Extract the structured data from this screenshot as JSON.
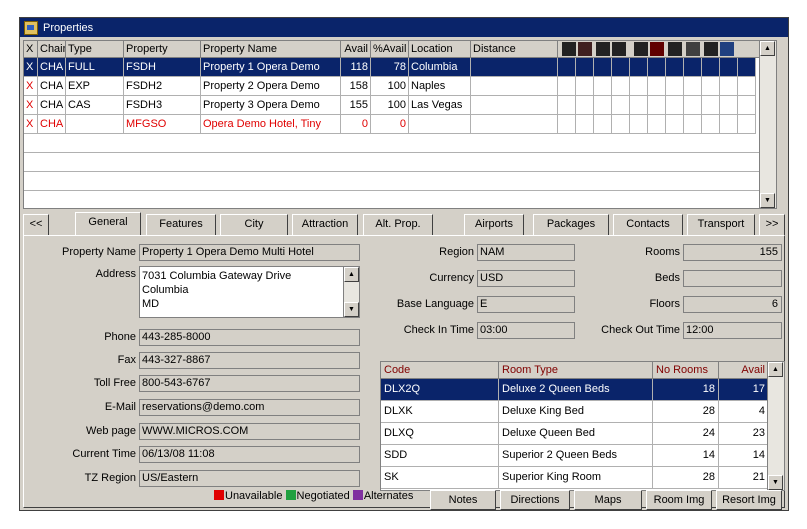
{
  "window": {
    "title": "Properties"
  },
  "grid": {
    "columns": [
      "X",
      "Chain",
      "Type",
      "Property",
      "Property Name",
      "Avail",
      "%Avail",
      "Location",
      "Distance"
    ],
    "rows": [
      {
        "x": "X",
        "chain": "CHA",
        "type": "FULL",
        "property": "FSDH",
        "name": "Property 1 Opera Demo",
        "avail": "118",
        "pavail": "78",
        "location": "Columbia",
        "distance": ""
      },
      {
        "x": "X",
        "chain": "CHA",
        "type": "EXP",
        "property": "FSDH2",
        "name": "Property 2 Opera Demo",
        "avail": "158",
        "pavail": "100",
        "location": "Naples",
        "distance": ""
      },
      {
        "x": "X",
        "chain": "CHA",
        "type": "CAS",
        "property": "FSDH3",
        "name": "Property 3 Opera Demo",
        "avail": "155",
        "pavail": "100",
        "location": "Las Vegas",
        "distance": ""
      },
      {
        "x": "X",
        "chain": "CHA",
        "type": "",
        "property": "MFGSO",
        "name": "Opera Demo Hotel, Tiny",
        "avail": "0",
        "pavail": "0",
        "location": "",
        "distance": ""
      }
    ]
  },
  "tabs": {
    "prev": "<<",
    "next": ">>",
    "items": [
      "General",
      "Features",
      "City",
      "Attraction",
      "Alt. Prop.",
      "Airports",
      "Packages",
      "Contacts",
      "Transport"
    ]
  },
  "general": {
    "property_name_label": "Property Name",
    "property_name": "Property 1 Opera Demo Multi Hotel",
    "address_label": "Address",
    "address_lines": [
      "7031 Columbia Gateway Drive",
      "Columbia",
      "MD"
    ],
    "phone_label": "Phone",
    "phone": "443-285-8000",
    "fax_label": "Fax",
    "fax": "443-327-8867",
    "tollfree_label": "Toll Free",
    "tollfree": "800-543-6767",
    "email_label": "E-Mail",
    "email": "reservations@demo.com",
    "web_label": "Web page",
    "web": "WWW.MICROS.COM",
    "time_label": "Current Time",
    "time": "06/13/08 11:08",
    "tz_label": "TZ Region",
    "tz": "US/Eastern",
    "region_label": "Region",
    "region": "NAM",
    "currency_label": "Currency",
    "currency": "USD",
    "language_label": "Base Language",
    "language": "E",
    "checkin_label": "Check In Time",
    "checkin": "03:00",
    "checkout_label": "Check Out Time",
    "checkout": "12:00",
    "rooms_label": "Rooms",
    "rooms": "155",
    "beds_label": "Beds",
    "beds": "",
    "floors_label": "Floors",
    "floors": "6"
  },
  "room_types": {
    "columns": [
      "Code",
      "Room Type",
      "No Rooms",
      "Avail"
    ],
    "rows": [
      {
        "code": "DLX2Q",
        "type": "Deluxe 2 Queen Beds",
        "no": "18",
        "avail": "17"
      },
      {
        "code": "DLXK",
        "type": "Deluxe King Bed",
        "no": "28",
        "avail": "4"
      },
      {
        "code": "DLXQ",
        "type": "Deluxe Queen Bed",
        "no": "24",
        "avail": "23"
      },
      {
        "code": "SDD",
        "type": "Superior 2 Queen Beds",
        "no": "14",
        "avail": "14"
      },
      {
        "code": "SK",
        "type": "Superior King Room",
        "no": "28",
        "avail": "21"
      }
    ]
  },
  "legend": {
    "unavailable": "Unavailable",
    "negotiated": "Negotiated",
    "alternates": "Alternates"
  },
  "colors": {
    "unavailable": "#e00000",
    "negotiated": "#20a040",
    "alternates": "#8030a0",
    "selection": "#0a246a"
  },
  "buttons": {
    "notes": "Notes",
    "directions": "Directions",
    "maps": "Maps",
    "room_img": "Room Img",
    "resort_img": "Resort Img"
  }
}
